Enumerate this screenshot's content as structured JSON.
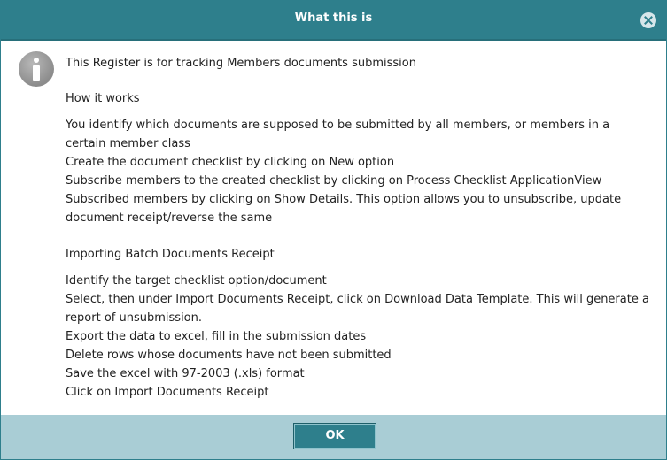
{
  "dialog": {
    "title": "What this is",
    "ok_label": "OK"
  },
  "content": {
    "intro": "This Register is for tracking Members documents submission",
    "how_it_works_heading": "How it works",
    "how_it_works_lines": [
      "You identify which documents are supposed to be submitted by all members, or members in a certain member class",
      "Create the document checklist by clicking on New option",
      "Subscribe members to the created checklist by clicking on Process Checklist ApplicationView Subscribed members by clicking on Show Details. This option allows you to unsubscribe, update document receipt/reverse the same"
    ],
    "import_heading": "Importing Batch Documents Receipt",
    "import_lines": [
      "Identify the target checklist option/document",
      "Select, then under Import Documents Receipt, click on Download Data Template. This will generate a report of unsubmission.",
      "Export the data to excel, fill in the submission dates",
      "Delete rows whose documents have not been submitted",
      "Save the excel with 97-2003 (.xls) format",
      "Click on Import Documents Receipt"
    ]
  },
  "icons": {
    "info": "info-icon",
    "close": "close-icon"
  },
  "colors": {
    "header": "#2e7f8c",
    "footer": "#a9cdd5",
    "button": "#2e7f8c"
  }
}
